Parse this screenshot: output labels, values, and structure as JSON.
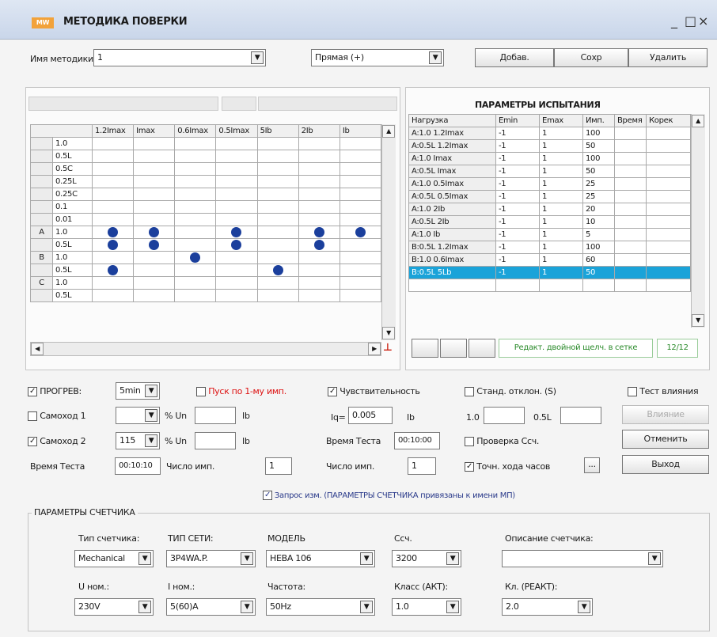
{
  "window": {
    "logo": "MW",
    "title": "МЕТОДИКА ПОВЕРКИ",
    "minimize": "_",
    "maximize": "□",
    "close": "×"
  },
  "top": {
    "method_label": "Имя методики",
    "method_value": "1",
    "direction_value": "Прямая (+)",
    "add_label": "Добав.",
    "save_label": "Сохр",
    "delete_label": "Удалить"
  },
  "matrix": {
    "columns": [
      "1.2Imax",
      "Imax",
      "0.6Imax",
      "0.5Imax",
      "5Ib",
      "2Ib",
      "Ib"
    ],
    "rows": [
      {
        "group": "",
        "pf": "1.0",
        "dots": [
          0,
          0,
          0,
          0,
          0,
          0,
          0
        ]
      },
      {
        "group": "",
        "pf": "0.5L",
        "dots": [
          0,
          0,
          0,
          0,
          0,
          0,
          0
        ]
      },
      {
        "group": "",
        "pf": "0.5C",
        "dots": [
          0,
          0,
          0,
          0,
          0,
          0,
          0
        ]
      },
      {
        "group": "",
        "pf": "0.25L",
        "dots": [
          0,
          0,
          0,
          0,
          0,
          0,
          0
        ]
      },
      {
        "group": "",
        "pf": "0.25C",
        "dots": [
          0,
          0,
          0,
          0,
          0,
          0,
          0
        ]
      },
      {
        "group": "",
        "pf": "0.1",
        "dots": [
          0,
          0,
          0,
          0,
          0,
          0,
          0
        ]
      },
      {
        "group": "",
        "pf": "0.01",
        "dots": [
          0,
          0,
          0,
          0,
          0,
          0,
          0
        ]
      },
      {
        "group": "A",
        "pf": "1.0",
        "dots": [
          1,
          1,
          0,
          1,
          0,
          1,
          1
        ]
      },
      {
        "group": "",
        "pf": "0.5L",
        "dots": [
          1,
          1,
          0,
          1,
          0,
          1,
          0
        ]
      },
      {
        "group": "B",
        "pf": "1.0",
        "dots": [
          0,
          0,
          1,
          0,
          0,
          0,
          0
        ]
      },
      {
        "group": "",
        "pf": "0.5L",
        "dots": [
          1,
          0,
          0,
          0,
          1,
          0,
          0
        ]
      },
      {
        "group": "C",
        "pf": "1.0",
        "dots": [
          0,
          0,
          0,
          0,
          0,
          0,
          0
        ]
      },
      {
        "group": "",
        "pf": "0.5L",
        "dots": [
          0,
          0,
          0,
          0,
          0,
          0,
          0
        ]
      }
    ]
  },
  "params": {
    "title": "ПАРАМЕТРЫ ИСПЫТАНИЯ",
    "headers": [
      "Нагрузка",
      "Emin",
      "Emax",
      "Имп.",
      "Время",
      "Корек"
    ],
    "rows": [
      [
        "A:1.0 1.2Imax",
        "-1",
        "1",
        "100",
        "",
        ""
      ],
      [
        "A:0.5L 1.2Imax",
        "-1",
        "1",
        "50",
        "",
        ""
      ],
      [
        "A:1.0 Imax",
        "-1",
        "1",
        "100",
        "",
        ""
      ],
      [
        "A:0.5L Imax",
        "-1",
        "1",
        "50",
        "",
        ""
      ],
      [
        "A:1.0 0.5Imax",
        "-1",
        "1",
        "25",
        "",
        ""
      ],
      [
        "A:0.5L 0.5Imax",
        "-1",
        "1",
        "25",
        "",
        ""
      ],
      [
        "A:1.0 2Ib",
        "-1",
        "1",
        "20",
        "",
        ""
      ],
      [
        "A:0.5L 2Ib",
        "-1",
        "1",
        "10",
        "",
        ""
      ],
      [
        "A:1.0 Ib",
        "-1",
        "1",
        "5",
        "",
        ""
      ],
      [
        "B:0.5L 1.2Imax",
        "-1",
        "1",
        "100",
        "",
        ""
      ],
      [
        "B:1.0 0.6Imax",
        "-1",
        "1",
        "60",
        "",
        ""
      ],
      [
        "B:0.5L 5Lb",
        "-1",
        "1",
        "50",
        "",
        ""
      ]
    ],
    "hint": "Редакт. двойной щелч. в сетке",
    "count": "12/12"
  },
  "options": {
    "warmup_label": "ПРОГРЕВ:",
    "warmup_value": "5min",
    "start_first_label": "Пуск по 1-му имп.",
    "creep1_label": "Самоход 1",
    "creep1_value": "",
    "creep2_label": "Самоход 2",
    "creep2_value": "115",
    "pct_un_label": "% Un",
    "ib_label": "Ib",
    "test_time_label": "Время Теста",
    "test_time_value": "00:10:10",
    "pulses_label": "Число имп.",
    "pulses_value": "1",
    "sens_label": "Чувствительность",
    "iq_label": "Iq=",
    "iq_value": "0.005",
    "sens_time_label": "Время Теста",
    "sens_time_value": "00:10:00",
    "sens_pulses_label": "Число имп.",
    "sens_pulses_value": "1",
    "stddev_label": "Станд. отклон. (S)",
    "pf1": "1.0",
    "pf2": "0.5L",
    "check_label": "Проверка Ссч.",
    "clock_label": "Точн. хода часов",
    "more": "...",
    "influence_label": "Тест влияния",
    "influence_btn": "Влияние",
    "cancel_btn": "Отменить",
    "exit_btn": "Выход",
    "request_label": "Запрос изм. (ПАРАМЕТРЫ СЧЕТЧИКА привязаны к имени МП)"
  },
  "meter": {
    "title": "ПАРАМЕТРЫ СЧЕТЧИКА",
    "type_label": "Тип счетчика:",
    "type_value": "Mechanical",
    "net_label": "ТИП СЕТИ:",
    "net_value": "3P4WA.P.",
    "model_label": "МОДЕЛЬ",
    "model_value": "НЕВА 106",
    "cc_label": "Ссч.",
    "cc_value": "3200",
    "desc_label": "Описание счетчика:",
    "desc_value": "",
    "un_label": "U ном.:",
    "un_value": "230V",
    "in_label": "I ном.:",
    "in_value": "5(60)A",
    "freq_label": "Частота:",
    "freq_value": "50Hz",
    "act_label": "Класс (АКТ):",
    "act_value": "1.0",
    "react_label": "Кл. (РЕАКТ):",
    "react_value": "2.0"
  }
}
